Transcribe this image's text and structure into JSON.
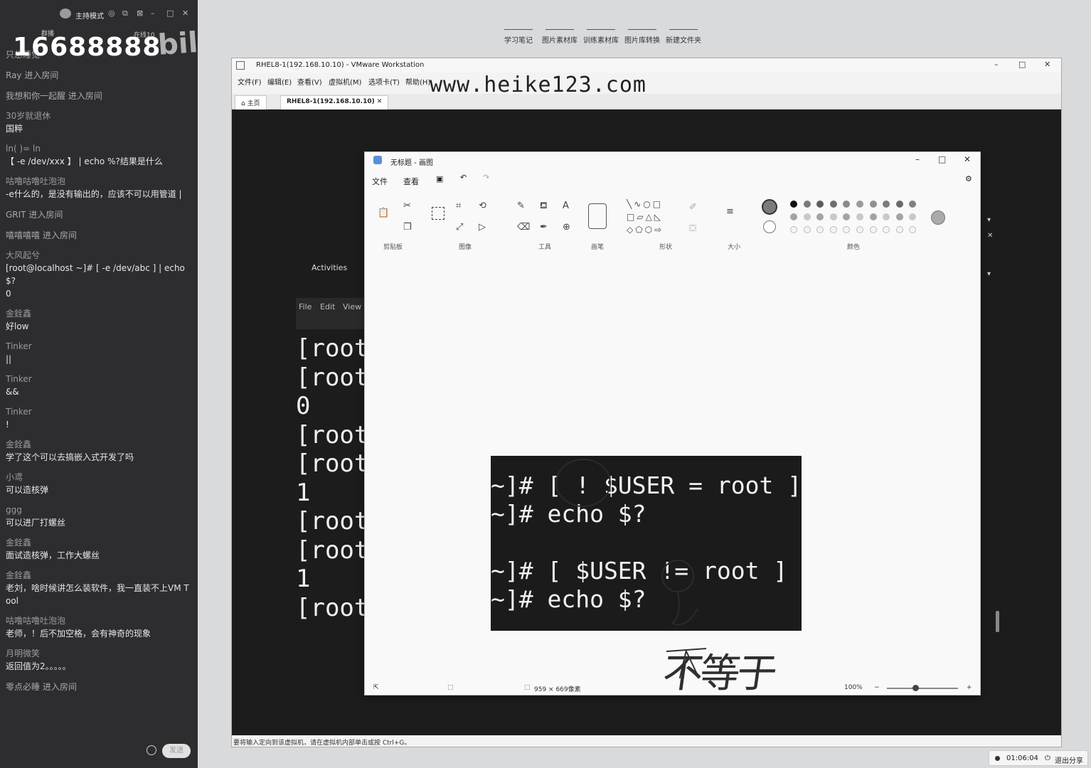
{
  "chat_panel": {
    "host_mode": "主持模式",
    "sub_left": "群播",
    "sub_right": "在线10",
    "room_number": "16688888",
    "logo_text": "bilibili",
    "send_label": "发送",
    "messages": [
      {
        "user": "",
        "text": "只想睡觉",
        "system": true
      },
      {
        "user": "",
        "text": "Ray 进入房间",
        "system": true
      },
      {
        "user": "",
        "text": "我想和你一起醒 进入房间",
        "system": true
      },
      {
        "user": "30岁就退休",
        "text": "国粹"
      },
      {
        "user": "ln(    )=     ln",
        "text": "【 -e /dev/xxx 】 | echo %?结果是什么"
      },
      {
        "user": "咕噜咕噜吐泡泡",
        "text": "-e什么的，是没有输出的，应该不可以用管道 |"
      },
      {
        "user": "",
        "text": "GRIT 进入房间",
        "system": true
      },
      {
        "user": "",
        "text": "嘻嘻嘻嘻 进入房间",
        "system": true
      },
      {
        "user": "大风起兮",
        "text": "[root@localhost ~]# [ -e /dev/abc ] | echo $?\n0"
      },
      {
        "user": "金銓鑫",
        "text": "好low"
      },
      {
        "user": "Tinker",
        "text": "||"
      },
      {
        "user": "Tinker",
        "text": "&&"
      },
      {
        "user": "Tinker",
        "text": "!"
      },
      {
        "user": "金銓鑫",
        "text": "学了这个可以去搞嵌入式开发了吗"
      },
      {
        "user": "小鸢",
        "text": "可以造核弹"
      },
      {
        "user": "ggg",
        "text": "可以进厂打螺丝"
      },
      {
        "user": "金銓鑫",
        "text": "面试造核弹，工作大螺丝"
      },
      {
        "user": "金銓鑫",
        "text": "老刘，啥时候讲怎么装软件，我一直装不上VM Tool"
      },
      {
        "user": "咕噜咕噜吐泡泡",
        "text": "老师，！后不加空格，会有神奇的现象"
      },
      {
        "user": "月明微笑",
        "text": "返回值为2。。。。。"
      },
      {
        "user": "",
        "text": "零点必睡 进入房间",
        "system": true
      }
    ]
  },
  "share_toolbar": [
    "学习笔记",
    "图片素材库",
    "训练素材库",
    "图片库转换",
    "新建文件夹"
  ],
  "vmware": {
    "title": "RHEL8-1(192.168.10.10) - VMware Workstation",
    "menu": [
      "文件(F)",
      "编辑(E)",
      "查看(V)",
      "虚拟机(M)",
      "选项卡(T)",
      "帮助(H)"
    ],
    "watermark": "www.heike123.com",
    "tabs": [
      "主页",
      "RHEL8-1(192.168.10.10)"
    ],
    "status_text": "要将输入定向到该虚拟机，请在虚拟机内部单击或按 Ctrl+G。",
    "guest": {
      "activities": "Activities",
      "term_menu": [
        "File",
        "Edit",
        "View"
      ],
      "terminal_lines": [
        "[root",
        "[root",
        "0",
        "[root",
        "[root",
        "1",
        "[root",
        "[root",
        "1",
        "[root"
      ]
    }
  },
  "paint": {
    "title": "无标题 - 画图",
    "menu": [
      "文件",
      "查看"
    ],
    "groups": [
      "剪贴板",
      "图像",
      "工具",
      "画笔",
      "形状",
      "大小",
      "颜色"
    ],
    "status_size": "959 × 669像素",
    "zoom": "100%",
    "pasted_lines": [
      "~]# [ ! $USER = root ]",
      "~]# echo $?",
      "",
      "~]# [ $USER != root ]",
      "~]# echo $?"
    ],
    "handwriting": "不等于",
    "palette": [
      "#111111",
      "#7a7a7a",
      "#5c5c5c",
      "#6e6e6e",
      "#8a8a8a",
      "#9c9c9c",
      "#8f8f8f",
      "#7b7b7b",
      "#6a6a6a",
      "#808080"
    ]
  },
  "share_control": {
    "timer": "01:06:04",
    "exit_label": "退出分享"
  }
}
